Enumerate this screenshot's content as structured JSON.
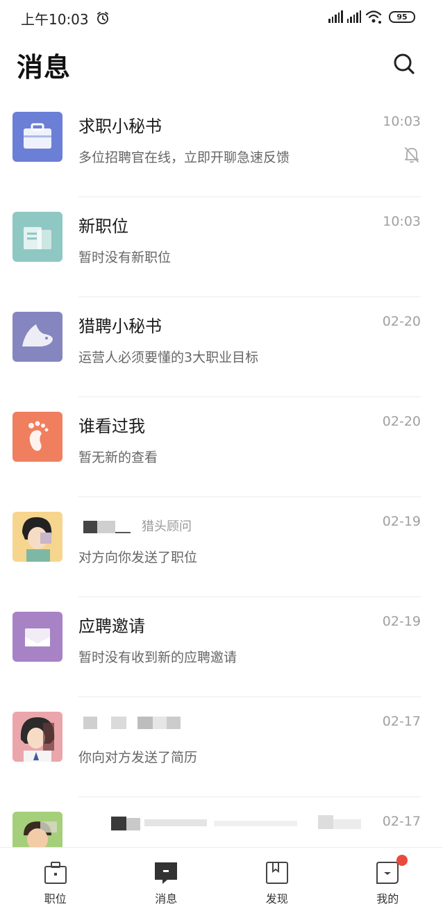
{
  "status_bar": {
    "time": "上午10:03",
    "battery": "95"
  },
  "header": {
    "title": "消息"
  },
  "messages": [
    {
      "name": "求职小秘书",
      "role": "",
      "time": "10:03",
      "preview": "多位招聘官在线，立即开聊急速反馈",
      "muted": true,
      "icon": "briefcase-icon",
      "color": "#6b7fd7"
    },
    {
      "name": "新职位",
      "role": "",
      "time": "10:03",
      "preview": "暂时没有新职位",
      "muted": false,
      "icon": "document-icon",
      "color": "#8fc7c3"
    },
    {
      "name": "猎聘小秘书",
      "role": "",
      "time": "02-20",
      "preview": "运营人必须要懂的3大职业目标",
      "muted": false,
      "icon": "bird-icon",
      "color": "#8585c0"
    },
    {
      "name": "谁看过我",
      "role": "",
      "time": "02-20",
      "preview": "暂无新的查看",
      "muted": false,
      "icon": "footprint-icon",
      "color": "#ef7f5f"
    },
    {
      "name": "",
      "role": "猎头顾问",
      "time": "02-19",
      "preview": "对方向你发送了职位",
      "muted": false,
      "icon": "person-avatar",
      "color": "#f2c97a"
    },
    {
      "name": "应聘邀请",
      "role": "",
      "time": "02-19",
      "preview": "暂时没有收到新的应聘邀请",
      "muted": false,
      "icon": "envelope-icon",
      "color": "#a782c5"
    },
    {
      "name": "",
      "role": "",
      "time": "02-17",
      "preview": "你向对方发送了简历",
      "muted": false,
      "icon": "person-avatar",
      "color": "#e9a3a8"
    },
    {
      "name": "",
      "role": "",
      "time": "02-17",
      "preview": "",
      "muted": false,
      "icon": "person-avatar",
      "color": "#9bc96f"
    }
  ],
  "tabbar": {
    "items": [
      {
        "label": "职位",
        "icon": "briefcase-icon"
      },
      {
        "label": "消息",
        "icon": "chat-icon"
      },
      {
        "label": "发现",
        "icon": "bookmark-icon"
      },
      {
        "label": "我的",
        "icon": "profile-icon"
      }
    ],
    "accent": "#e84a3c"
  }
}
